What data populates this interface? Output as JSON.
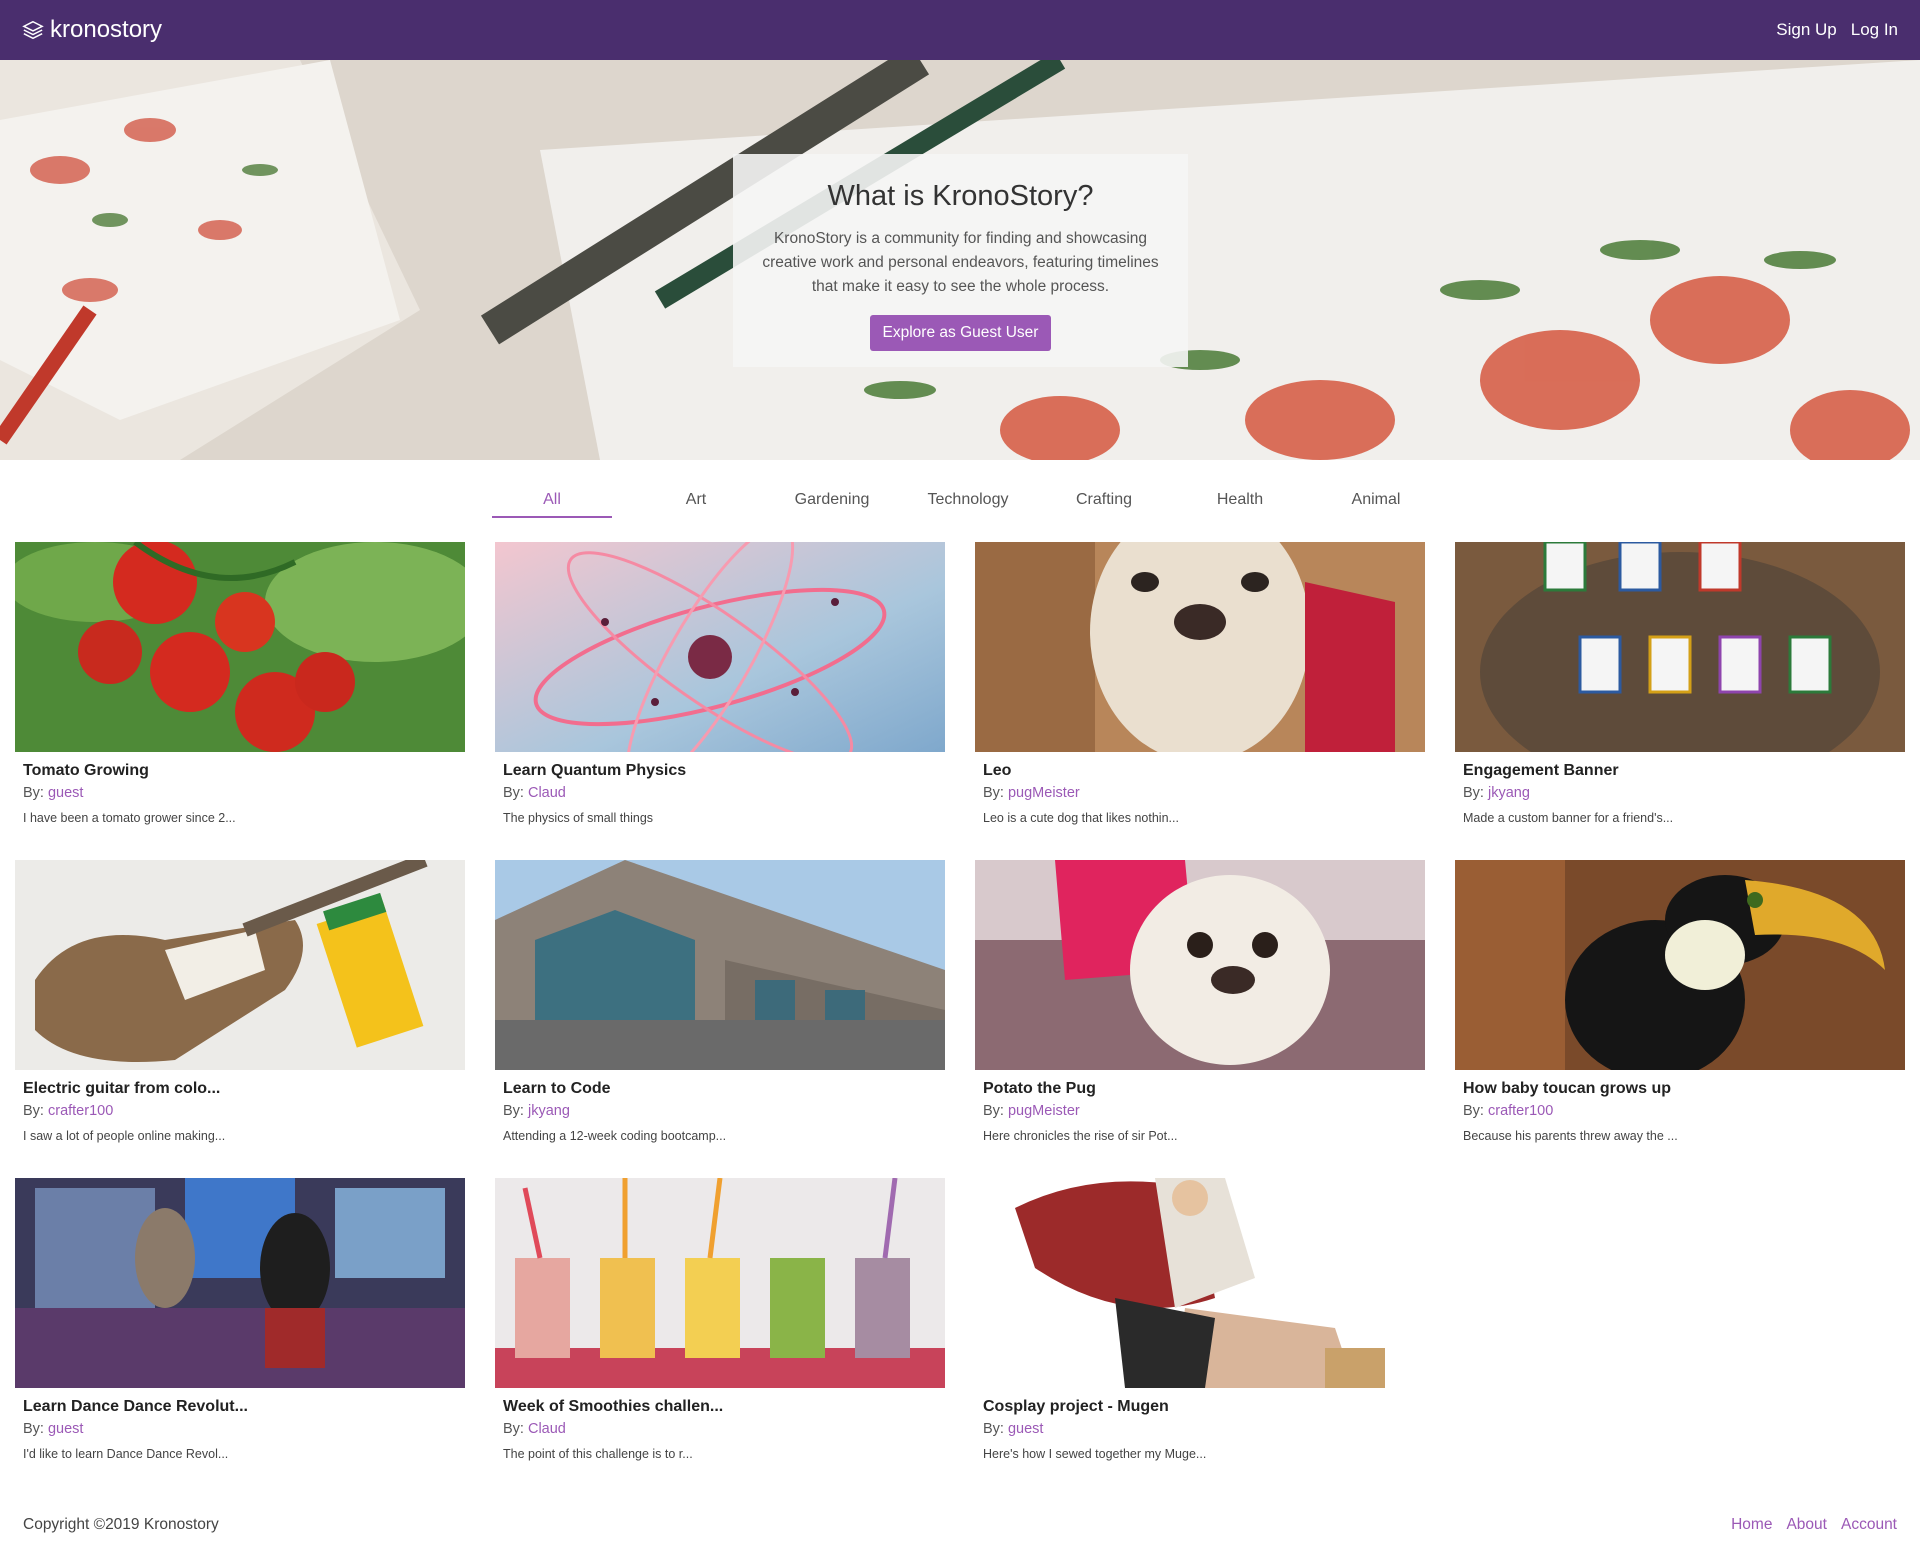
{
  "nav": {
    "brand": "kronostory",
    "logo_icon": "stack-layers-icon",
    "sign_up": "Sign Up",
    "log_in": "Log In",
    "bg_color": "#4a2e6e"
  },
  "hero": {
    "title": "What is KronoStory?",
    "description": "KronoStory is a community for finding and showcasing creative work and personal endeavors, featuring timelines that make it easy to see the whole process.",
    "button": "Explore as Guest User",
    "accent": "#9b59b6"
  },
  "tabs": [
    "All",
    "Art",
    "Gardening",
    "Technology",
    "Crafting",
    "Health",
    "Animal"
  ],
  "active_tab": "All",
  "cards": [
    {
      "title": "Tomato Growing",
      "by_label": "By:",
      "author": "guest",
      "desc": "I have been a tomato grower since 2..."
    },
    {
      "title": "Learn Quantum Physics",
      "by_label": "By:",
      "author": "Claud",
      "desc": "The physics of small things"
    },
    {
      "title": "Leo",
      "by_label": "By:",
      "author": "pugMeister",
      "desc": "Leo is a cute dog that likes nothin..."
    },
    {
      "title": "Engagement Banner",
      "by_label": "By:",
      "author": "jkyang",
      "desc": "Made a custom banner for a friend's..."
    },
    {
      "title": "Electric guitar from colo...",
      "by_label": "By:",
      "author": "crafter100",
      "desc": "I saw a lot of people online making..."
    },
    {
      "title": "Learn to Code",
      "by_label": "By:",
      "author": "jkyang",
      "desc": "Attending a 12-week coding bootcamp..."
    },
    {
      "title": "Potato the Pug",
      "by_label": "By:",
      "author": "pugMeister",
      "desc": "Here chronicles the rise of sir Pot..."
    },
    {
      "title": "How baby toucan grows up",
      "by_label": "By:",
      "author": "crafter100",
      "desc": "Because his parents threw away the ..."
    },
    {
      "title": "Learn Dance Dance Revolut...",
      "by_label": "By:",
      "author": "guest",
      "desc": "I'd like to learn Dance Dance Revol..."
    },
    {
      "title": "Week of Smoothies challen...",
      "by_label": "By:",
      "author": "Claud",
      "desc": "The point of this challenge is to r..."
    },
    {
      "title": "Cosplay project - Mugen",
      "by_label": "By:",
      "author": "guest",
      "desc": "Here's how I sewed together my Muge..."
    }
  ],
  "footer": {
    "copyright": "Copyright ©2019 Kronostory",
    "links": [
      "Home",
      "About",
      "Account"
    ]
  }
}
